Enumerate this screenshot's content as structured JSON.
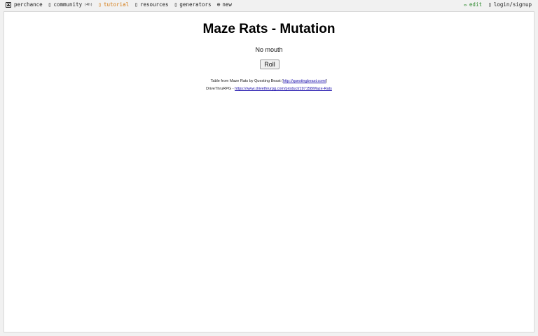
{
  "nav": {
    "brand": "perchance",
    "community": "community",
    "community_count": "(4h)",
    "tutorial": "tutorial",
    "resources": "resources",
    "generators": "generators",
    "new": "new",
    "edit": "edit",
    "login": "login/signup"
  },
  "icons": {
    "brand": "die-icon",
    "community": "chat-icon",
    "tutorial": "book-icon",
    "resources": "link-icon",
    "generators": "grid-icon",
    "new": "plus-circle-icon",
    "edit": "pencil-icon",
    "login": "user-icon"
  },
  "colors": {
    "tutorial": "#d47a12",
    "edit": "#2f8a2f",
    "link": "#1a0dab"
  },
  "main": {
    "title": "Maze Rats - Mutation",
    "result": "No mouth",
    "roll_label": "Roll",
    "credit1_prefix": "Table from Maze Rats by Questing Beast (",
    "credit1_link": "http://questingbeast.com/",
    "credit1_suffix": ")",
    "credit2_prefix": "DriveThruRPG - ",
    "credit2_link": "https://www.drivethrurpg.com/product/197158/Maze-Rats"
  }
}
